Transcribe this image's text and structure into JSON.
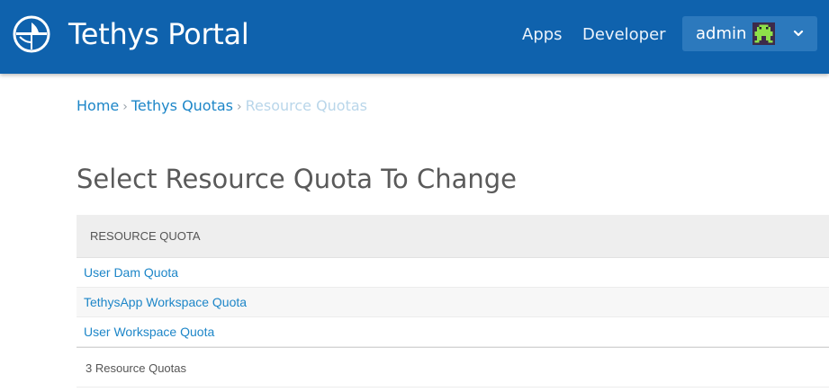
{
  "header": {
    "brand": "Tethys Portal",
    "nav": {
      "apps": "Apps",
      "developer": "Developer"
    },
    "user": {
      "name": "admin"
    },
    "colors": {
      "header_bg": "#0f62ad",
      "user_menu_bg": "#2c79bd",
      "link": "#1d86c8"
    }
  },
  "breadcrumb": {
    "home": "Home",
    "parent": "Tethys Quotas",
    "current": "Resource Quotas",
    "separator": "›"
  },
  "page": {
    "title": "Select Resource Quota To Change"
  },
  "table": {
    "column_header": "Resource quota",
    "rows": [
      {
        "label": "User Dam Quota"
      },
      {
        "label": "TethysApp Workspace Quota"
      },
      {
        "label": "User Workspace Quota"
      }
    ],
    "count_text": "3 Resource Quotas"
  },
  "icons": {
    "logo": "tethys-logo-icon",
    "avatar": "pixel-avatar-icon",
    "caret": "chevron-down-icon"
  }
}
